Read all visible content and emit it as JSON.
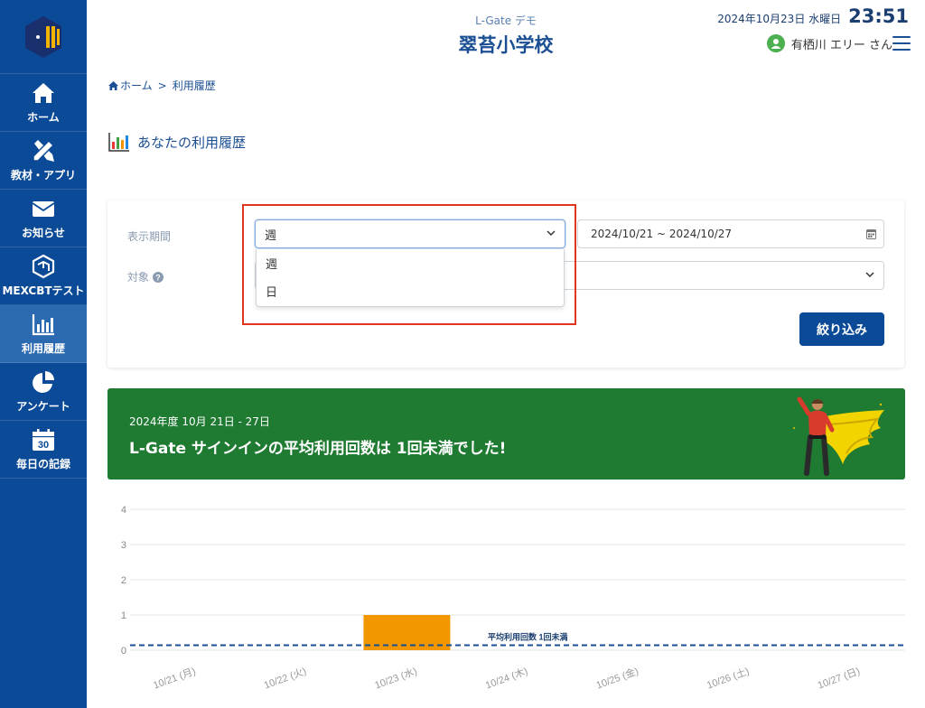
{
  "sidebar": {
    "logo": "l-gate-logo",
    "items": [
      {
        "label": "ホーム",
        "icon": "home-icon"
      },
      {
        "label": "教材・アプリ",
        "icon": "tools-icon"
      },
      {
        "label": "お知らせ",
        "icon": "envelope-icon"
      },
      {
        "label": "MEXCBTテスト",
        "icon": "cube-icon"
      },
      {
        "label": "利用履歴",
        "icon": "bar-chart-icon",
        "active": true
      },
      {
        "label": "アンケート",
        "icon": "pie-chart-icon"
      },
      {
        "label": "毎日の記録",
        "icon": "calendar-icon",
        "badge": "30"
      }
    ]
  },
  "header": {
    "subtitle": "L-Gate デモ",
    "title": "翠苔小学校",
    "date": "2024年10月23日 水曜日",
    "time": "23:51",
    "user_name": "有栖川 エリー さん"
  },
  "breadcrumb": {
    "home": "ホーム",
    "separator": ">",
    "current": "利用履歴"
  },
  "page_title": "あなたの利用履歴",
  "filter": {
    "period_label": "表示期間",
    "period_selected": "週",
    "period_options": [
      "週",
      "日"
    ],
    "date_range": "2024/10/21 ~ 2024/10/27",
    "target_label": "対象",
    "target_selected": "",
    "submit_label": "絞り込み"
  },
  "banner": {
    "period": "2024年度 10月 21日 - 27日",
    "message": "L-Gate サインインの平均利用回数は 1回未満でした!"
  },
  "colors": {
    "brand": "#0b4a96",
    "banner": "#1f7a32",
    "bar": "#f39700",
    "avg_line": "#1b4f94",
    "highlight": "#e0351f"
  },
  "chart_data": {
    "type": "bar",
    "categories": [
      "10/21 (月)",
      "10/22 (火)",
      "10/23 (水)",
      "10/24 (木)",
      "10/25 (金)",
      "10/26 (土)",
      "10/27 (日)"
    ],
    "values": [
      0,
      0,
      1,
      0,
      0,
      0,
      0
    ],
    "ylim": [
      0,
      4
    ],
    "yticks": [
      0,
      1,
      2,
      3,
      4
    ],
    "average_line": {
      "value": 0.14,
      "label": "平均利用回数 1回未満"
    },
    "grid": true
  }
}
